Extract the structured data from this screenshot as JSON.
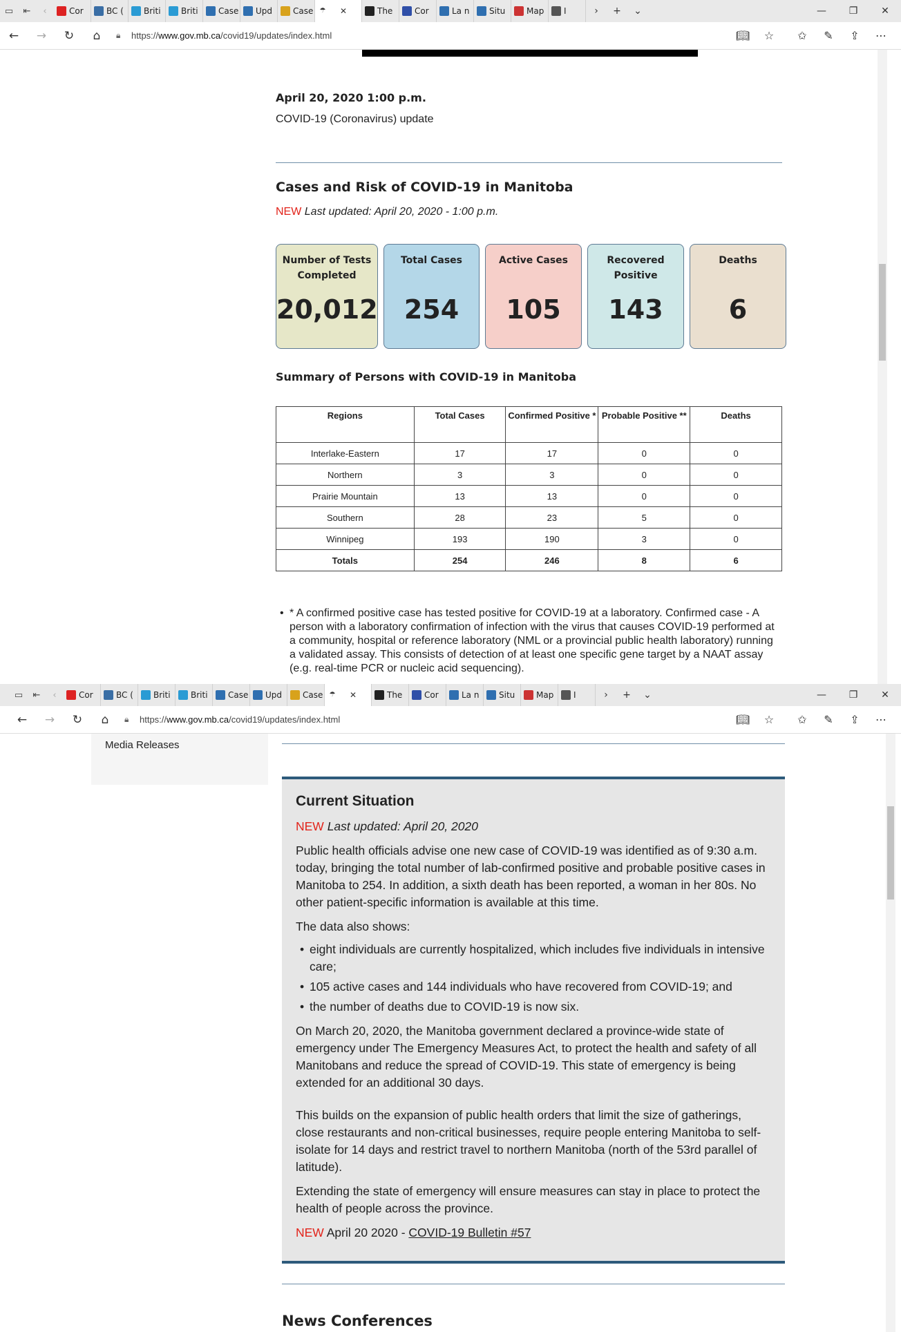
{
  "browser_top": {
    "tabs": [
      {
        "label": "Cor",
        "color": "#d22"
      },
      {
        "label": "BC (",
        "color": "#3a6ea5"
      },
      {
        "label": "Briti",
        "color": "#2a9bd4"
      },
      {
        "label": "Briti",
        "color": "#2a9bd4"
      },
      {
        "label": "Case",
        "color": "#2f6fb0"
      },
      {
        "label": "Upd",
        "color": "#2f6fb0"
      },
      {
        "label": "Case",
        "color": "#d8a21c"
      }
    ],
    "tabs_after": [
      {
        "label": "The",
        "color": "#222"
      },
      {
        "label": "Cor",
        "color": "#2f4fa8"
      },
      {
        "label": "La n",
        "color": "#2f6fb0"
      },
      {
        "label": "Situ",
        "color": "#2f6fb0"
      },
      {
        "label": "Map",
        "color": "#c33"
      },
      {
        "label": "I",
        "color": "#555"
      }
    ],
    "url_prefix": "https://",
    "url_host": "www.gov.mb.ca",
    "url_path": "/covid19/updates/index.html"
  },
  "update": {
    "datetime": "April 20, 2020 1:00 p.m.",
    "subtitle": "COVID-19 (Coronavirus) update"
  },
  "cases": {
    "heading": "Cases and Risk of COVID-19 in Manitoba",
    "new_label": "NEW",
    "last_updated": "Last updated: April 20, 2020 - 1:00 p.m.",
    "cards": [
      {
        "label": "Number of Tests Completed",
        "value": "20,012",
        "color": "#e6e7c8"
      },
      {
        "label": "Total Cases",
        "value": "254",
        "color": "#b4d7e8"
      },
      {
        "label": "Active Cases",
        "value": "105",
        "color": "#f6cfc9"
      },
      {
        "label": "Recovered Positive",
        "value": "143",
        "color": "#cfe8e8"
      },
      {
        "label": "Deaths",
        "value": "6",
        "color": "#eadfcf"
      }
    ]
  },
  "summary": {
    "heading": "Summary of Persons with COVID-19 in Manitoba",
    "columns": [
      "Regions",
      "Total Cases",
      "Confirmed Positive *",
      "Probable Positive **",
      "Deaths"
    ],
    "rows": [
      [
        "Interlake-Eastern",
        "17",
        "17",
        "0",
        "0"
      ],
      [
        "Northern",
        "3",
        "3",
        "0",
        "0"
      ],
      [
        "Prairie Mountain",
        "13",
        "13",
        "0",
        "0"
      ],
      [
        "Southern",
        "28",
        "23",
        "5",
        "0"
      ],
      [
        "Winnipeg",
        "193",
        "190",
        "3",
        "0"
      ]
    ],
    "totals": [
      "Totals",
      "254",
      "246",
      "8",
      "6"
    ],
    "note1": "* A confirmed positive case has tested positive for COVID-19 at a laboratory. Confirmed case - A person with a laboratory confirmation of infection with the virus that causes COVID-19 performed at a community, hospital or reference laboratory (NML or a provincial public health laboratory) running a validated assay. This consists of detection of at least one specific gene target by a NAAT assay (e.g. real-time PCR or nucleic acid sequencing)."
  },
  "sidebar": {
    "media_releases": "Media Releases"
  },
  "current": {
    "title": "Current Situation",
    "new_label": "NEW",
    "last_updated": "Last updated: April 20, 2020",
    "p1": "Public health officials advise one new case of COVID-19 was identified as of 9:30 a.m. today, bringing the total number of lab-confirmed positive and probable positive cases in Manitoba to 254. In addition, a sixth death has been reported, a woman in her 80s. No other patient-specific information is available at this time.",
    "p2": "The data also shows:",
    "bullets": [
      "eight individuals are currently hospitalized, which includes five individuals in intensive care;",
      "105 active cases and 144 individuals who have recovered from COVID-19; and",
      "the number of deaths due to COVID-19 is now six."
    ],
    "p3": "On March 20, 2020, the Manitoba government declared a province-wide state of emergency under The Emergency Measures Act, to protect the health and safety of all Manitobans and reduce the spread of COVID-19. This state of emergency is being extended for an additional 30 days.",
    "p4": "This builds on the expansion of public health orders that limit the size of gatherings, close restaurants and non-critical businesses, require people entering Manitoba to self-isolate for 14 days and restrict travel to northern Manitoba (north of the 53rd parallel of latitude).",
    "p5": "Extending the state of emergency will ensure measures can stay in place to protect the health of people across the province.",
    "bulletin_date": "April 20 2020 - ",
    "bulletin_link": "COVID-19 Bulletin #57"
  },
  "news_conferences": "News Conferences"
}
